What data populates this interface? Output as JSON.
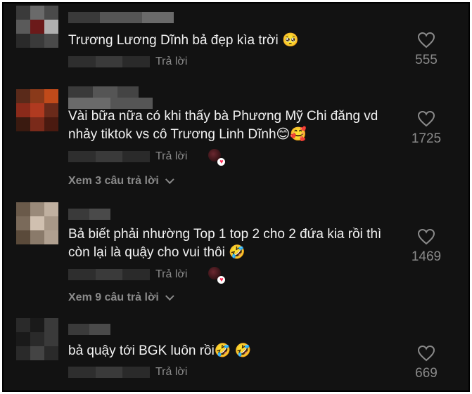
{
  "comments": [
    {
      "text": "Trương Lương Dĩnh bả đẹp kìa trời 🥺",
      "reply_label": "Trả lời",
      "likes": "555",
      "avatar_colors": [
        "#3a3a3a",
        "#6a6a6a",
        "#4a4a4a",
        "#5a5a5a",
        "#6b1a1a",
        "#b0b0b0",
        "#2a2a2a",
        "#3a3a3a",
        "#4a4a4a"
      ]
    },
    {
      "text": "Vài bữa nữa có khi thấy bà Phương Mỹ Chi đăng vd nhảy tiktok vs cô Trương Linh Dĩnh😊🥰",
      "reply_label": "Trả lời",
      "likes": "1725",
      "view_replies": "Xem 3 câu trả lời",
      "avatar_colors": [
        "#5a2a1a",
        "#8a3a1a",
        "#c04a1a",
        "#8a2a1a",
        "#b03a20",
        "#6a2a1a",
        "#3a1a10",
        "#7a2a1a",
        "#4a1a10"
      ]
    },
    {
      "text": "Bả biết phải nhường Top 1 top 2 cho 2 đứa kia rồi thì còn lại là quậy cho vui thôi 🤣",
      "reply_label": "Trả lời",
      "likes": "1469",
      "view_replies": "Xem 9 câu trả lời",
      "avatar_colors": [
        "#6a5a4a",
        "#9a8a7a",
        "#c0b0a0",
        "#7a6a5a",
        "#d0c0b0",
        "#a89888",
        "#5a4a3a",
        "#8a7a6a",
        "#b0a090"
      ]
    },
    {
      "text": "bả quậy tới BGK luôn rồi🤣 🤣",
      "reply_label": "Trả lời",
      "likes": "669",
      "avatar_colors": [
        "#2a2a2a",
        "#1a1a1a",
        "#3a3a3a",
        "#1a1a1a",
        "#2a2a2a",
        "#3a3a3a",
        "#2a2a2a",
        "#444444",
        "#2a2a2a"
      ]
    }
  ],
  "colors": {
    "background": "#121212",
    "text": "#f2f2f2",
    "muted": "#8a8a8a",
    "accent": "#fe2c55"
  },
  "icons": {
    "like": "heart-outline-icon",
    "creator_liked": "creator-liked-avatar-icon",
    "expand": "chevron-down-icon"
  }
}
